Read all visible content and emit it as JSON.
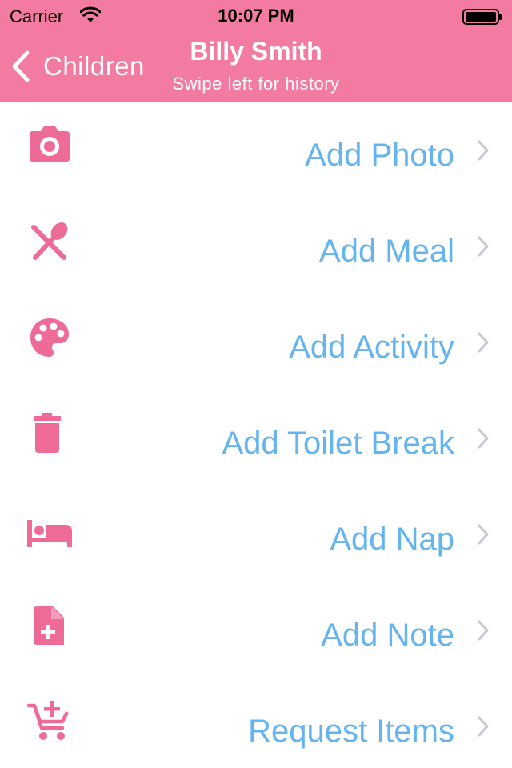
{
  "status_bar": {
    "carrier": "Carrier",
    "time": "10:07 PM",
    "icons": [
      "wifi-icon",
      "battery-icon"
    ]
  },
  "nav": {
    "back_label": "Children",
    "title": "Billy Smith",
    "subtitle": "Swipe left for history",
    "background_color": "#f37aa0"
  },
  "actions": [
    {
      "label": "Add Photo",
      "icon": "camera-icon"
    },
    {
      "label": "Add Meal",
      "icon": "utensils-icon"
    },
    {
      "label": "Add Activity",
      "icon": "palette-icon"
    },
    {
      "label": "Add Toilet Break",
      "icon": "trash-icon"
    },
    {
      "label": "Add Nap",
      "icon": "bed-icon"
    },
    {
      "label": "Add Note",
      "icon": "note-add-icon"
    },
    {
      "label": "Request Items",
      "icon": "cart-add-icon"
    }
  ],
  "colors": {
    "icon": "#ee6a97",
    "label": "#64b4ef",
    "chevron": "#c7c7cc"
  }
}
